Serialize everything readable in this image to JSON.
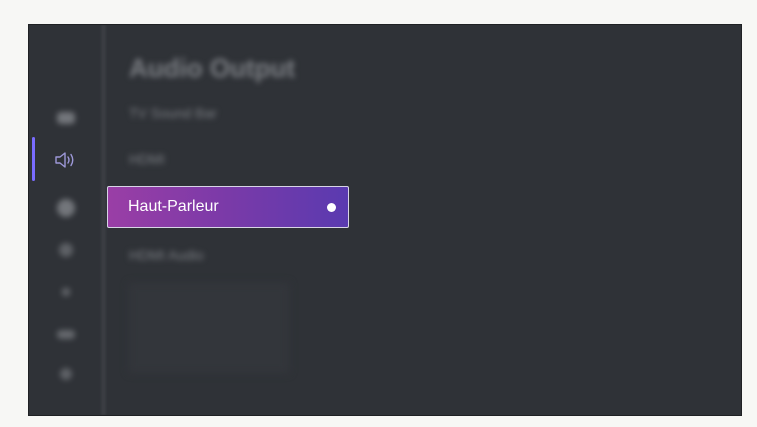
{
  "panel": {
    "title": "Audio Output"
  },
  "menu": {
    "items": [
      {
        "label": "TV Sound Bar",
        "selected": false
      },
      {
        "label": "HDMI",
        "selected": false
      },
      {
        "label": "Haut-Parleur",
        "selected": true
      },
      {
        "label": "HDMI Audio",
        "selected": false
      }
    ]
  },
  "rail": {
    "icons": [
      "picture-icon",
      "sound-icon",
      "network-icon",
      "apps-icon",
      "accessibility-icon",
      "general-icon",
      "support-icon"
    ],
    "active_icon": "sound-icon"
  },
  "colors": {
    "screen_bg": "#2f3237",
    "selection_gradient_start": "#9a3ea6",
    "selection_gradient_end": "#5a3ab0",
    "rail_indicator": "#7a6cff"
  }
}
